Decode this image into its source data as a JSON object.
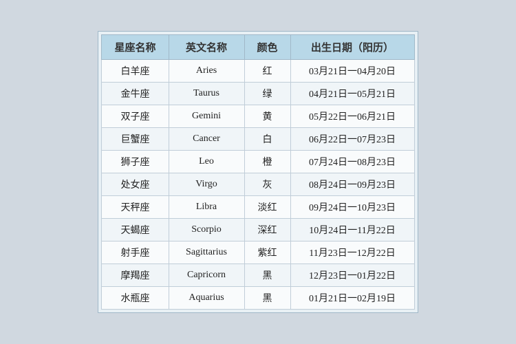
{
  "table": {
    "headers": [
      "星座名称",
      "英文名称",
      "颜色",
      "出生日期（阳历）"
    ],
    "rows": [
      {
        "chinese": "白羊座",
        "english": "Aries",
        "color": "红",
        "date": "03月21日一04月20日"
      },
      {
        "chinese": "金牛座",
        "english": "Taurus",
        "color": "绿",
        "date": "04月21日一05月21日"
      },
      {
        "chinese": "双子座",
        "english": "Gemini",
        "color": "黄",
        "date": "05月22日一06月21日"
      },
      {
        "chinese": "巨蟹座",
        "english": "Cancer",
        "color": "白",
        "date": "06月22日一07月23日"
      },
      {
        "chinese": "狮子座",
        "english": "Leo",
        "color": "橙",
        "date": "07月24日一08月23日"
      },
      {
        "chinese": "处女座",
        "english": "Virgo",
        "color": "灰",
        "date": "08月24日一09月23日"
      },
      {
        "chinese": "天秤座",
        "english": "Libra",
        "color": "淡红",
        "date": "09月24日一10月23日"
      },
      {
        "chinese": "天蝎座",
        "english": "Scorpio",
        "color": "深红",
        "date": "10月24日一11月22日"
      },
      {
        "chinese": "射手座",
        "english": "Sagittarius",
        "color": "紫红",
        "date": "11月23日一12月22日"
      },
      {
        "chinese": "摩羯座",
        "english": "Capricorn",
        "color": "黑",
        "date": "12月23日一01月22日"
      },
      {
        "chinese": "水瓶座",
        "english": "Aquarius",
        "color": "黑",
        "date": "01月21日一02月19日"
      }
    ]
  }
}
